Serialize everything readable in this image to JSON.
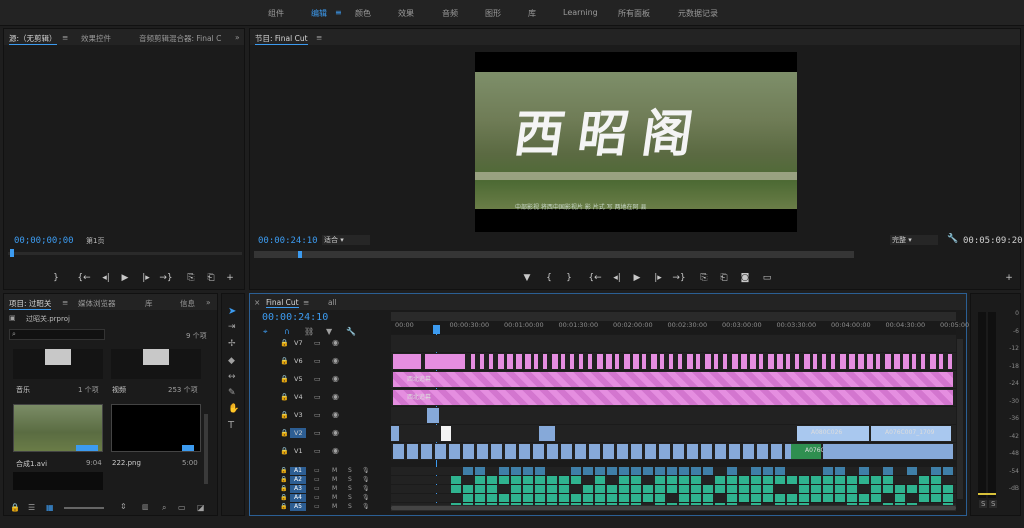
{
  "workspaces": [
    {
      "label": "组件",
      "active": false
    },
    {
      "label": "编辑",
      "active": true
    },
    {
      "label": "颜色",
      "active": false
    },
    {
      "label": "效果",
      "active": false
    },
    {
      "label": "音频",
      "active": false
    },
    {
      "label": "图形",
      "active": false
    },
    {
      "label": "库",
      "active": false
    },
    {
      "label": "Learning",
      "active": false
    },
    {
      "label": "所有面板",
      "active": false
    },
    {
      "label": "元数据记录",
      "active": false
    }
  ],
  "source_panel": {
    "tabs": [
      "源:（无剪辑）",
      "效果控件",
      "音频剪辑混合器: Final C"
    ],
    "timecode": "00;00;00;00",
    "page": "第1页"
  },
  "program_panel": {
    "tab": "节目: Final Cut",
    "timecode": "00:00:24:10",
    "fit": "适合",
    "quality": "完整",
    "duration": "00:05:09:20",
    "title_art": "西昭阁",
    "subtitle_line": "中部影视  将西中国影视片 影 片式 写  两地在阿 县"
  },
  "project_panel": {
    "tabs": [
      "项目: 过昭关",
      "媒体浏览器",
      "库",
      "信息"
    ],
    "file": "过昭关.prproj",
    "count": "9 个项",
    "items": [
      {
        "name": "音乐",
        "meta": "1 个项"
      },
      {
        "name": "视频",
        "meta": "253 个项"
      },
      {
        "name": "合成1.avi",
        "meta": "9:04"
      },
      {
        "name": "222.png",
        "meta": "5:00"
      }
    ]
  },
  "timeline": {
    "tabs": [
      "Final Cut",
      "all"
    ],
    "timecode": "00:00:24:10",
    "ruler": [
      "00:00",
      "00:00:30:00",
      "00:01:00:00",
      "00:01:30:00",
      "00:02:00:00",
      "00:02:30:00",
      "00:03:00:00",
      "00:03:30:00",
      "00:04:00:00",
      "00:04:30:00",
      "00:05:00:00"
    ],
    "video_tracks": [
      "V7",
      "V6",
      "V5",
      "V4",
      "V3",
      "V2",
      "V1"
    ],
    "audio_tracks": [
      "A1",
      "A2",
      "A3",
      "A4",
      "A5"
    ],
    "clip_labels": {
      "v5": "西北追幕",
      "v4": "西北追幕",
      "v2a": "A080C026",
      "v2b": "A076C007_1709",
      "v1": "A076C"
    },
    "track_letters": {
      "m": "M",
      "s": "S"
    }
  },
  "meters": [
    "0",
    "-6",
    "-12",
    "-18",
    "-24",
    "-30",
    "-36",
    "-42",
    "-48",
    "-54",
    "-dB"
  ],
  "meter_buttons": [
    "S",
    "S"
  ],
  "colors": {
    "accent": "#3c9bf0",
    "pink": "#e58ee0",
    "blue": "#86a9d9",
    "green": "#2fb38f"
  }
}
